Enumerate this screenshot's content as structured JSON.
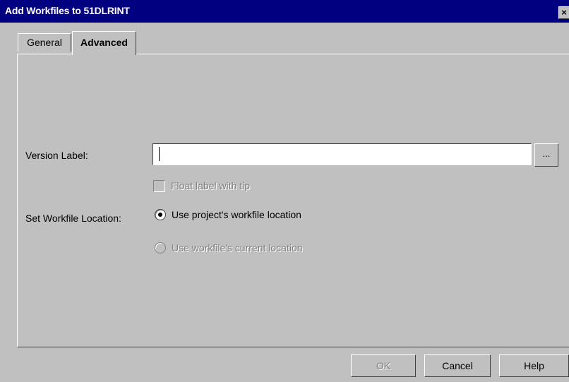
{
  "window": {
    "title": "Add Workfiles to 51DLRINT",
    "close_glyph": "×"
  },
  "tabs": [
    {
      "label": "General",
      "selected": false
    },
    {
      "label": "Advanced",
      "selected": true
    }
  ],
  "form": {
    "version_label": {
      "label": "Version Label:",
      "value": "",
      "browse_label": "..."
    },
    "float_label": {
      "label": "Float label with tip",
      "checked": false,
      "enabled": false
    },
    "workfile_location": {
      "label": "Set Workfile Location:",
      "options": [
        {
          "label": "Use project's workfile location",
          "selected": true,
          "enabled": true
        },
        {
          "label": "Use workfile's current location",
          "selected": false,
          "enabled": false
        }
      ]
    }
  },
  "buttons": {
    "ok": "OK",
    "cancel": "Cancel",
    "help": "Help"
  },
  "colors": {
    "titlebar": "#000080",
    "face": "#c0c0c0",
    "disabled_text": "#808080"
  }
}
